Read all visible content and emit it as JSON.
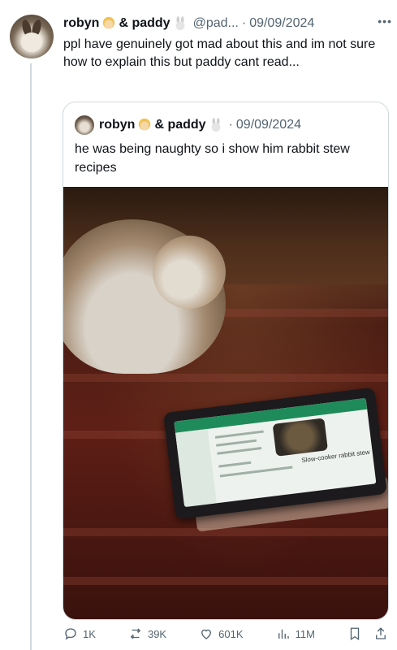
{
  "tweet": {
    "author_name": "robyn",
    "author_suffix": "& paddy",
    "handle": "@pad...",
    "sep": "·",
    "date": "09/09/2024",
    "text": "ppl have genuinely got mad about this and im not sure how to explain this but paddy cant read..."
  },
  "quote": {
    "author_name": "robyn",
    "author_suffix": "& paddy",
    "sep": "·",
    "date": "09/09/2024",
    "text": "he was being naughty so i show him rabbit stew recipes",
    "screen_title": "Slow-cooker rabbit stew"
  },
  "actions": {
    "replies": "1K",
    "reposts": "39K",
    "likes": "601K",
    "views": "11M"
  },
  "icons": {
    "more": "more-icon",
    "reply": "reply-icon",
    "repost": "repost-icon",
    "like": "heart-icon",
    "views": "views-icon",
    "bookmark": "bookmark-icon",
    "share": "share-icon"
  }
}
